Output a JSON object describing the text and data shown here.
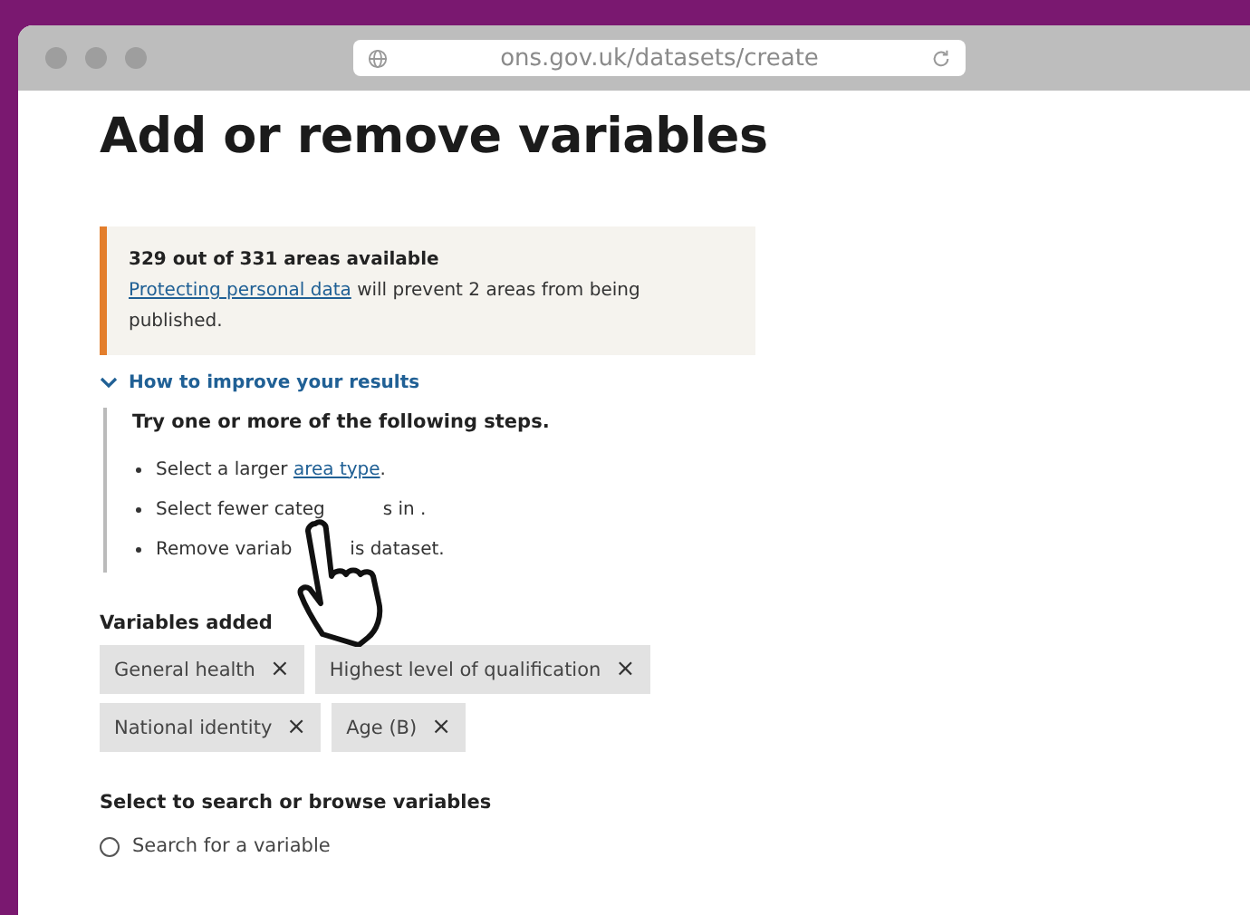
{
  "browser": {
    "url": "ons.gov.uk/datasets/create"
  },
  "page": {
    "title": "Add or remove variables"
  },
  "notice": {
    "heading": "329 out of 331 areas available",
    "link": "Protecting personal data",
    "text": " will prevent 2 areas from being published."
  },
  "details": {
    "summary": "How to improve your results",
    "expanded": true,
    "intro": "Try one or more of the following steps.",
    "steps": [
      {
        "segments": [
          {
            "kind": "text",
            "text": "Select a larger "
          },
          {
            "kind": "link",
            "text": "area type"
          },
          {
            "kind": "text",
            "text": "."
          }
        ]
      },
      {
        "segments": [
          {
            "kind": "text",
            "text": "Select fewer categ"
          },
          {
            "kind": "covered"
          },
          {
            "kind": "text",
            "text": "s in ."
          }
        ]
      },
      {
        "segments": [
          {
            "kind": "text",
            "text": "Remove variab"
          },
          {
            "kind": "covered"
          },
          {
            "kind": "text",
            "text": "is dataset."
          }
        ]
      }
    ]
  },
  "variables": {
    "label": "Variables added",
    "chips": [
      {
        "label": "General health",
        "remove": "×"
      },
      {
        "label": "Highest level of qualification",
        "remove": "×"
      },
      {
        "label": "National identity",
        "remove": "×"
      },
      {
        "label": "Age (B)",
        "remove": "×"
      }
    ]
  },
  "browse": {
    "label": "Select to search or browse variables",
    "options": [
      {
        "label": "Search for a variable",
        "selected": false
      }
    ]
  }
}
